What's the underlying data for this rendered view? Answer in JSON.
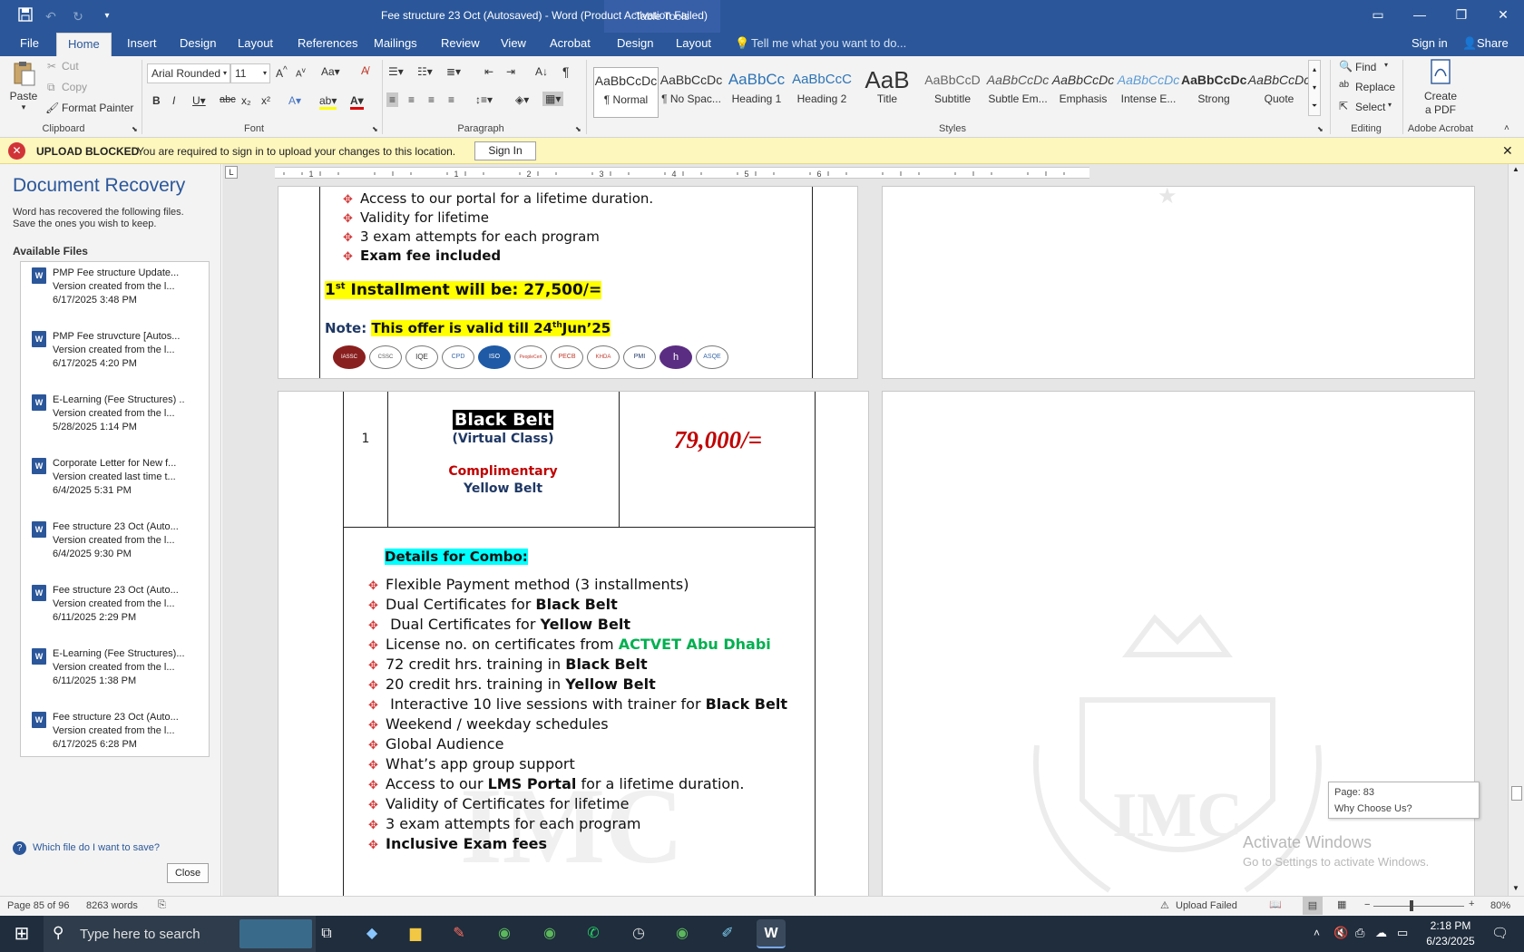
{
  "window": {
    "title": "Fee structure 23 Oct (Autosaved) - Word (Product Activation Failed)",
    "table_tools": "Table Tools"
  },
  "tabs": [
    "File",
    "Home",
    "Insert",
    "Design",
    "Layout",
    "References",
    "Mailings",
    "Review",
    "View",
    "Acrobat",
    "Design",
    "Layout"
  ],
  "tell_me": "Tell me what you want to do...",
  "sign_in": "Sign in",
  "share": "Share",
  "clipboard": {
    "paste": "Paste",
    "cut": "Cut",
    "copy": "Copy",
    "format_painter": "Format Painter",
    "label": "Clipboard"
  },
  "font": {
    "name": "Arial Rounded",
    "size": "11",
    "label": "Font"
  },
  "paragraph": {
    "label": "Paragraph"
  },
  "styles": {
    "label": "Styles",
    "items": [
      {
        "preview": "AaBbCcDc",
        "name": "¶ Normal"
      },
      {
        "preview": "AaBbCcDc",
        "name": "¶ No Spac..."
      },
      {
        "preview": "AaBbCc",
        "name": "Heading 1"
      },
      {
        "preview": "AaBbCcC",
        "name": "Heading 2"
      },
      {
        "preview": "AaB",
        "name": "Title"
      },
      {
        "preview": "AaBbCcD",
        "name": "Subtitle"
      },
      {
        "preview": "AaBbCcDc",
        "name": "Subtle Em..."
      },
      {
        "preview": "AaBbCcDc",
        "name": "Emphasis"
      },
      {
        "preview": "AaBbCcDc",
        "name": "Intense E..."
      },
      {
        "preview": "AaBbCcDc",
        "name": "Strong"
      },
      {
        "preview": "AaBbCcDc",
        "name": "Quote"
      }
    ]
  },
  "editing": {
    "find": "Find",
    "replace": "Replace",
    "select": "Select",
    "label": "Editing"
  },
  "acrobat": {
    "create_l1": "Create",
    "create_l2": "a PDF",
    "label": "Adobe Acrobat"
  },
  "infobar": {
    "title": "UPLOAD BLOCKED",
    "message": "You are required to sign in to upload your changes to this location.",
    "button": "Sign In"
  },
  "recovery": {
    "title": "Document Recovery",
    "desc_l1": "Word has recovered the following files.",
    "desc_l2": "Save the ones you wish to keep.",
    "available": "Available Files",
    "files": [
      {
        "name": "PMP Fee structure Update...",
        "note": "Version created from the l...",
        "date": "6/17/2025 3:48 PM"
      },
      {
        "name": "PMP Fee struvcture  [Autos...",
        "note": "Version created from the l...",
        "date": "6/17/2025 4:20 PM"
      },
      {
        "name": "E-Learning (Fee Structures) ..",
        "note": "Version created from the l...",
        "date": "5/28/2025 1:14 PM"
      },
      {
        "name": "Corporate Letter for New f...",
        "note": "Version created last time t...",
        "date": "6/4/2025 5:31 PM"
      },
      {
        "name": "Fee structure 23 Oct (Auto...",
        "note": "Version created from the l...",
        "date": "6/4/2025 9:30 PM"
      },
      {
        "name": "Fee structure 23 Oct (Auto...",
        "note": "Version created from the l...",
        "date": "6/11/2025 2:29 PM"
      },
      {
        "name": "E-Learning (Fee Structures)...",
        "note": "Version created from the l...",
        "date": "6/11/2025 1:38 PM"
      },
      {
        "name": "Fee structure 23 Oct (Auto...",
        "note": "Version created from the l...",
        "date": "6/17/2025 6:28 PM"
      }
    ],
    "which_file": "Which file do I want to save?",
    "close": "Close"
  },
  "page_top": {
    "bullets": [
      "Access to our portal for a lifetime duration.",
      "Validity for lifetime",
      "3 exam attempts for each program",
      "Exam fee included"
    ],
    "installment_pre": "1",
    "installment_sup": "st",
    "installment_post": " Installment will be: 27,500/=",
    "note_label": "Note:",
    "note_pre": "This offer is valid till 24",
    "note_sup": "th",
    "note_post": "Jun’25",
    "logos": [
      "IASSC",
      "CSSC",
      "IQE",
      "CPD",
      "ISO",
      "PeopleCert",
      "PECB",
      "KHDA",
      "PMI",
      "h",
      "ASQE"
    ]
  },
  "page_main": {
    "row_no": "1",
    "course": "Black Belt",
    "course_mode": "(Virtual Class)",
    "complimentary": "Complimentary",
    "complimentary_course": "Yellow Belt",
    "price": "79,000/=",
    "details_heading": "Details for Combo:",
    "bullets": [
      {
        "pre": "Flexible Payment method (3 installments)",
        "b": "",
        "g": ""
      },
      {
        "pre": "Dual Certificates for ",
        "b": "Black Belt",
        "g": ""
      },
      {
        "pre": " Dual Certificates for ",
        "b": "Yellow Belt",
        "g": ""
      },
      {
        "pre": "License no. on certificates from ",
        "b": "",
        "g": "ACTVET Abu Dhabi"
      },
      {
        "pre": "72 credit hrs. training in ",
        "b": "Black Belt",
        "g": ""
      },
      {
        "pre": "20 credit hrs. training in ",
        "b": "Yellow Belt",
        "g": ""
      },
      {
        "pre": " Interactive 10 live sessions with trainer for ",
        "b": "Black Belt",
        "g": ""
      },
      {
        "pre": "Weekend / weekday schedules",
        "b": "",
        "g": ""
      },
      {
        "pre": "Global Audience",
        "b": "",
        "g": ""
      },
      {
        "pre": "What’s app group support",
        "b": "",
        "g": ""
      },
      {
        "pre": "Access to our ",
        "b": "LMS Portal",
        "g": "",
        "post": " for a lifetime duration."
      },
      {
        "pre": "Validity of Certificates for lifetime",
        "b": "",
        "g": ""
      },
      {
        "pre": "3 exam attempts for each program",
        "b": "",
        "g": ""
      },
      {
        "pre": "",
        "b": "Inclusive Exam fees",
        "g": ""
      }
    ]
  },
  "watermark": "IMC",
  "tooltip": {
    "page": "Page: 83",
    "heading": "Why Choose Us?"
  },
  "activate": {
    "title": "Activate Windows",
    "sub": "Go to Settings to activate Windows."
  },
  "status": {
    "page": "Page 85 of 96",
    "words": "8263 words",
    "upload": "Upload Failed",
    "zoom": "80%"
  },
  "taskbar": {
    "search": "Type here to search",
    "time": "2:18 PM",
    "date": "6/23/2025"
  },
  "colors": {
    "accent": "#2b579a",
    "highlight_yellow": "#ffff00",
    "highlight_cyan": "#00ffff",
    "price_red": "#c00000",
    "green": "#00b050"
  }
}
